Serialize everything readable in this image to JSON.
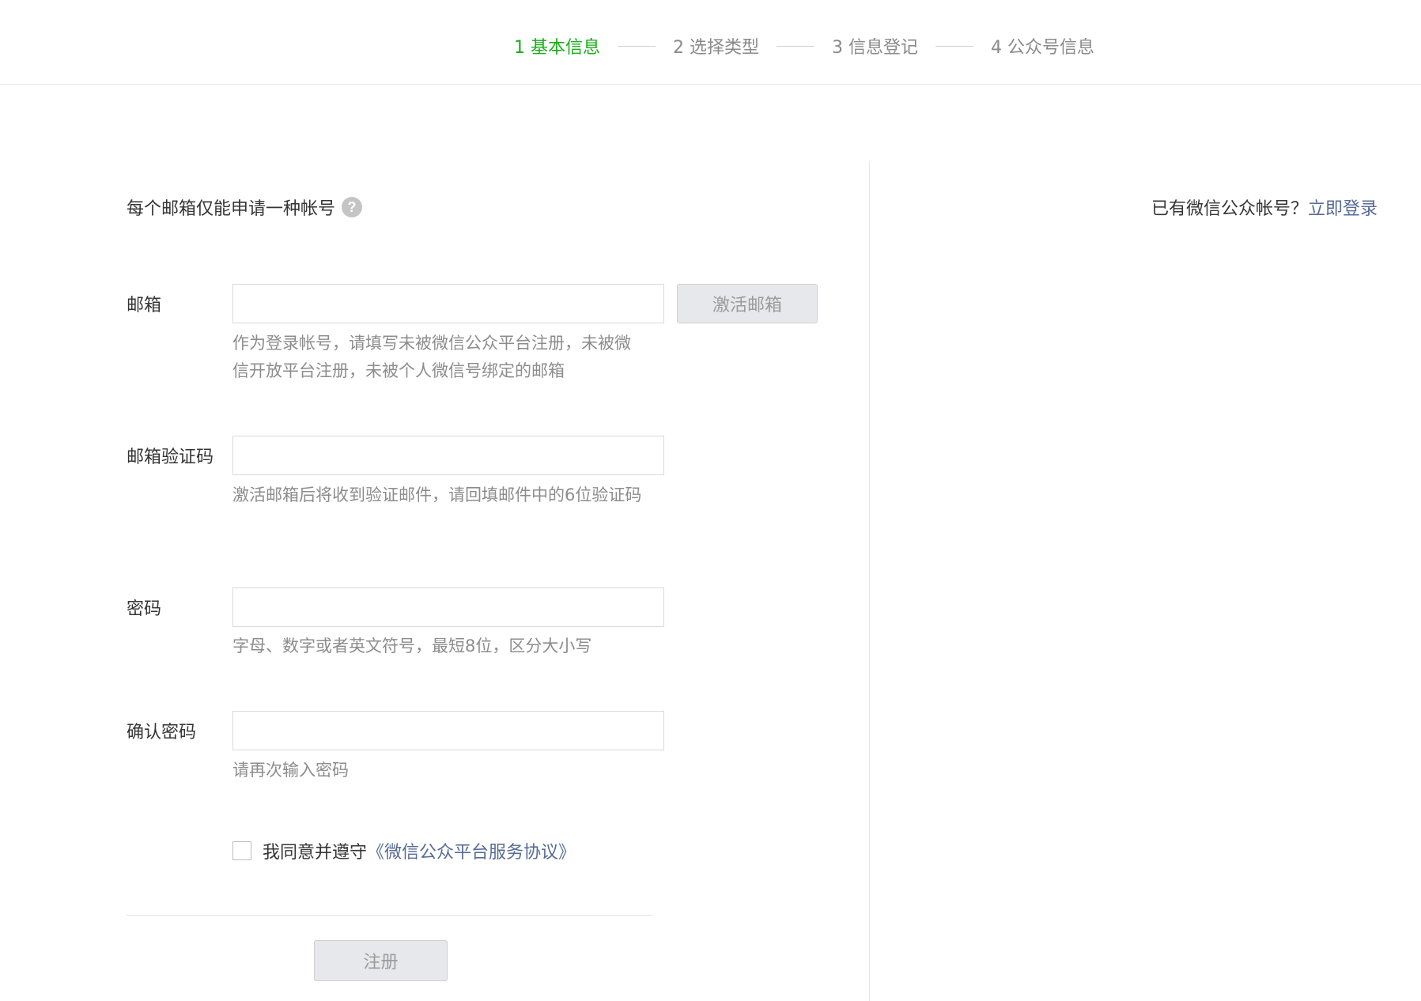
{
  "steps": [
    {
      "label": "1 基本信息",
      "active": true
    },
    {
      "label": "2 选择类型",
      "active": false
    },
    {
      "label": "3 信息登记",
      "active": false
    },
    {
      "label": "4 公众号信息",
      "active": false
    }
  ],
  "notice": {
    "text": "每个邮箱仅能申请一种帐号",
    "icon": "help-icon",
    "icon_glyph": "?"
  },
  "login": {
    "prompt": "已有微信公众帐号？",
    "link": "立即登录"
  },
  "form": {
    "email": {
      "label": "邮箱",
      "value": "",
      "hint": "作为登录帐号，请填写未被微信公众平台注册，未被微信开放平台注册，未被个人微信号绑定的邮箱",
      "activate_label": "激活邮箱"
    },
    "code": {
      "label": "邮箱验证码",
      "value": "",
      "hint": "激活邮箱后将收到验证邮件，请回填邮件中的6位验证码"
    },
    "password": {
      "label": "密码",
      "value": "",
      "hint": "字母、数字或者英文符号，最短8位，区分大小写"
    },
    "confirm": {
      "label": "确认密码",
      "value": "",
      "hint": "请再次输入密码"
    }
  },
  "agreement": {
    "checked": false,
    "text": "我同意并遵守",
    "link": "《微信公众平台服务协议》"
  },
  "submit": {
    "label": "注册"
  },
  "colors": {
    "active_step": "#1aad19",
    "link": "#576b95",
    "hint": "#8c8c8c",
    "button_bg": "#e7e8eb"
  }
}
